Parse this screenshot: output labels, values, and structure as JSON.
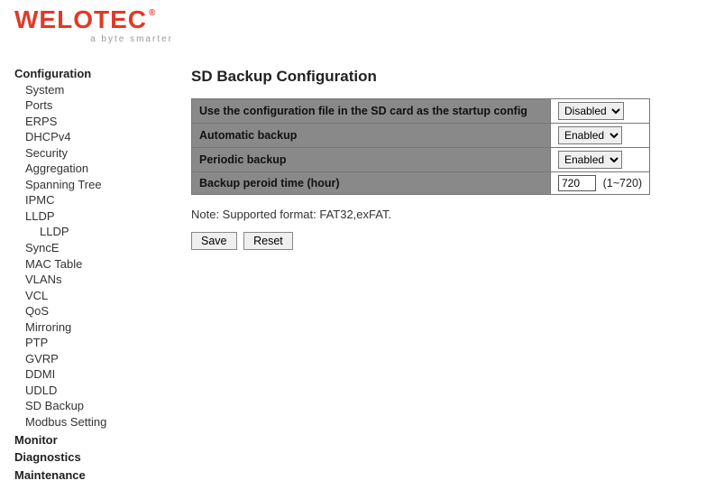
{
  "brand": {
    "name": "WELOTEC",
    "registered": "®",
    "tagline": "a byte smarter"
  },
  "sidebar": {
    "sections": [
      {
        "label": "Configuration",
        "items": [
          {
            "label": "System"
          },
          {
            "label": "Ports"
          },
          {
            "label": "ERPS"
          },
          {
            "label": "DHCPv4"
          },
          {
            "label": "Security"
          },
          {
            "label": "Aggregation"
          },
          {
            "label": "Spanning Tree"
          },
          {
            "label": "IPMC"
          },
          {
            "label": "LLDP",
            "children": [
              {
                "label": "LLDP"
              }
            ]
          },
          {
            "label": "SyncE"
          },
          {
            "label": "MAC Table"
          },
          {
            "label": "VLANs"
          },
          {
            "label": "VCL"
          },
          {
            "label": "QoS"
          },
          {
            "label": "Mirroring"
          },
          {
            "label": "PTP"
          },
          {
            "label": "GVRP"
          },
          {
            "label": "DDMI"
          },
          {
            "label": "UDLD"
          },
          {
            "label": "SD Backup"
          },
          {
            "label": "Modbus Setting"
          }
        ]
      },
      {
        "label": "Monitor",
        "items": []
      },
      {
        "label": "Diagnostics",
        "items": []
      },
      {
        "label": "Maintenance",
        "items": []
      }
    ]
  },
  "content": {
    "title": "SD Backup Configuration",
    "rows": [
      {
        "label": "Use the configuration file in the SD card as the startup config",
        "type": "select",
        "value": "Disabled"
      },
      {
        "label": "Automatic backup",
        "type": "select",
        "value": "Enabled"
      },
      {
        "label": "Periodic backup",
        "type": "select",
        "value": "Enabled"
      },
      {
        "label": "Backup peroid time (hour)",
        "type": "number",
        "value": "720",
        "range": "(1~720)"
      }
    ],
    "note": "Note: Supported format: FAT32,exFAT.",
    "buttons": {
      "save": "Save",
      "reset": "Reset"
    }
  }
}
